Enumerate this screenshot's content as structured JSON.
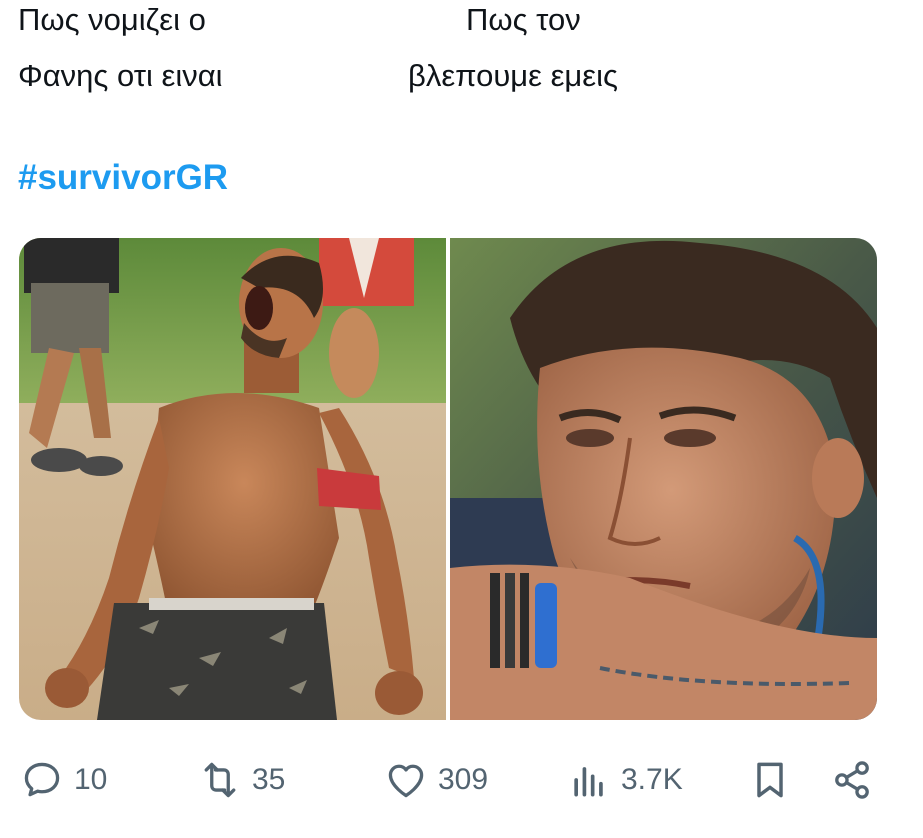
{
  "caption": {
    "left_lines": [
      "Πως νομιζει ο",
      "Φανης οτι ειναι"
    ],
    "right_lines": [
      "Πως τον",
      "βλεπουμε εμεις"
    ]
  },
  "hashtag": "#survivorGR",
  "media": {
    "left_photo": "shirtless man kneeling on sand screaming with red armband",
    "right_photo": "close-up of tired man resting head on tattooed arm"
  },
  "actions": {
    "reply": {
      "icon": "reply-icon",
      "count": "10"
    },
    "retweet": {
      "icon": "retweet-icon",
      "count": "35"
    },
    "like": {
      "icon": "heart-icon",
      "count": "309"
    },
    "views": {
      "icon": "views-icon",
      "count": "3.7K"
    },
    "bookmark": {
      "icon": "bookmark-icon"
    },
    "share": {
      "icon": "share-icon"
    }
  },
  "colors": {
    "hashtag": "#1d9bf0",
    "action_gray": "#536471",
    "text": "#0f1419"
  }
}
